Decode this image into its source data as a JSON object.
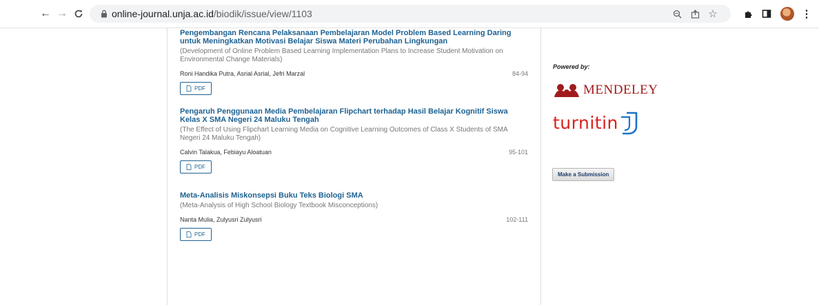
{
  "browser": {
    "url_host": "online-journal.unja.ac.id",
    "url_path": "/biodik/issue/view/1103",
    "icons": [
      "back-arrow-icon",
      "forward-arrow-icon",
      "reload-icon",
      "lock-icon",
      "zoom-icon",
      "share-icon",
      "star-icon",
      "extensions-puzzle-icon",
      "side-panel-icon",
      "profile-avatar",
      "kebab-menu-icon"
    ]
  },
  "articles": [
    {
      "title": "Pengembangan Rencana Pelaksanaan Pembelajaran Model Problem Based Learning Daring untuk Meningkatkan Motivasi Belajar Siswa Materi Perubahan Lingkungan",
      "subtitle": "(Development of Online Problem Based Learning Implementation Plans to Increase Student Motivation on Environmental Change Materials)",
      "authors": "Roni Handika Putra, Asrial Asrial, Jefri Marzal",
      "pages": "84-94",
      "pdf_label": "PDF"
    },
    {
      "title": "Pengaruh Penggunaan Media Pembelajaran Flipchart terhadap Hasil Belajar Kognitif Siswa Kelas X SMA Negeri 24 Maluku Tengah",
      "subtitle": "(The Effect of Using Flipchart Learning Media on Cognitive Learning Outcomes of Class X Students of SMA Negeri 24 Maluku Tengah)",
      "authors": "Calvin Talakua, Febiayu Aloatuan",
      "pages": "95-101",
      "pdf_label": "PDF"
    },
    {
      "title": "Meta-Analisis Miskonsepsi Buku Teks Biologi SMA",
      "subtitle": "(Meta-Analysis of High School Biology Textbook Misconceptions)",
      "authors": "Nanta Mulia, Zulyusri Zulyusri",
      "pages": "102-111",
      "pdf_label": "PDF"
    }
  ],
  "sidebar": {
    "powered_by": "Powered by:",
    "mendeley": "MENDELEY",
    "turnitin": "turnitin",
    "submit_label": "Make a Submission"
  },
  "colors": {
    "link": "#1e6292",
    "mendeley": "#a01c1c",
    "turnitin": "#d9221c"
  }
}
